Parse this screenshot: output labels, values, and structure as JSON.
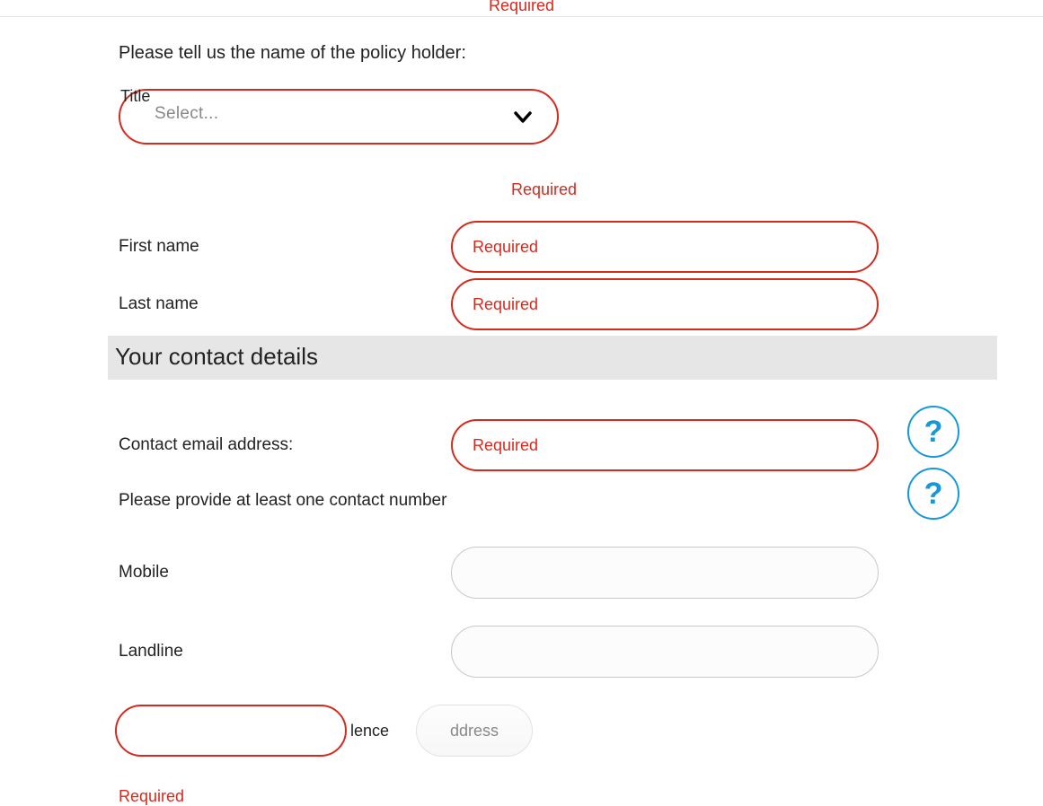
{
  "top_required": "Required",
  "policy_holder_heading": "Please tell us the name of the policy holder:",
  "title": {
    "label": "Title",
    "selected": "Select..."
  },
  "title_required": "Required",
  "first_name": {
    "label": "First name",
    "placeholder": "Required"
  },
  "last_name": {
    "label": "Last name",
    "placeholder": "Required"
  },
  "contact_section_heading": "Your contact details",
  "email": {
    "label": "Contact email address:",
    "placeholder": "Required"
  },
  "contact_number_heading": "Please provide at least one contact number",
  "mobile": {
    "label": "Mobile"
  },
  "landline": {
    "label": "Landline"
  },
  "partial_fragment_left": "lence",
  "partial_fragment_toggle": "ddress",
  "bottom_required": "Required",
  "help_glyph": "?"
}
